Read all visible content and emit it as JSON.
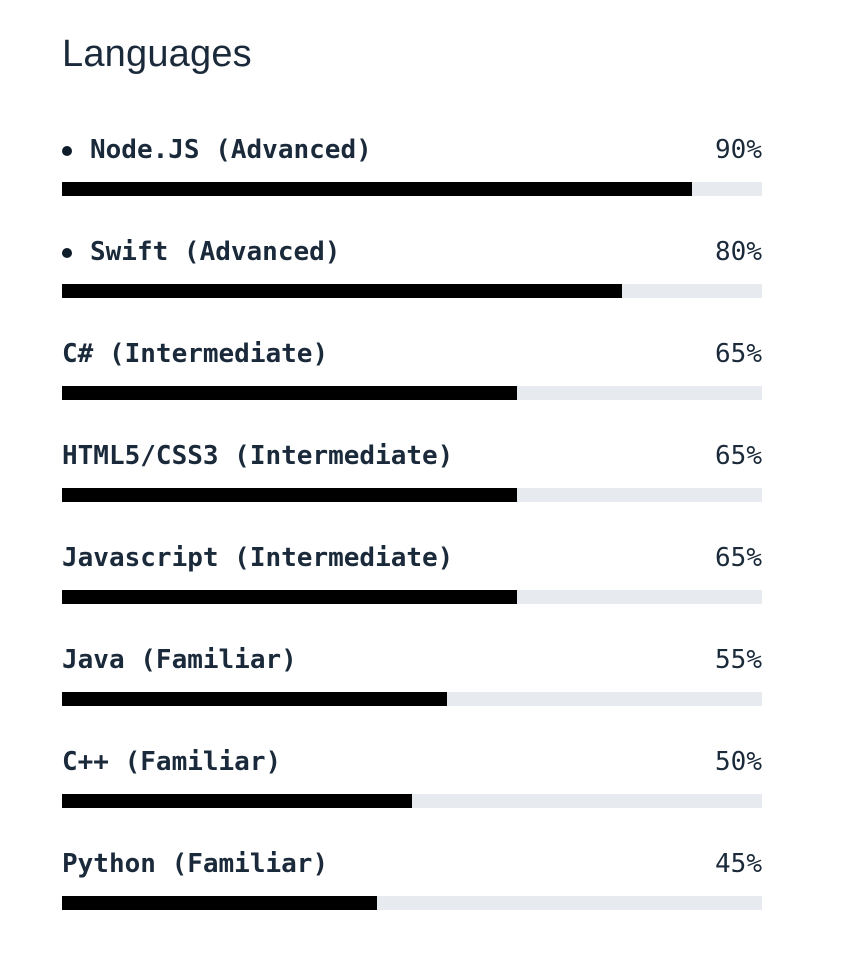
{
  "section": {
    "title": "Languages"
  },
  "skills": [
    {
      "name": "Node.JS (Advanced)",
      "percent_label": "90%",
      "level": 0.9,
      "bullet": true
    },
    {
      "name": "Swift (Advanced)",
      "percent_label": "80%",
      "level": 0.8,
      "bullet": true
    },
    {
      "name": "C# (Intermediate)",
      "percent_label": "65%",
      "level": 0.65,
      "bullet": false
    },
    {
      "name": "HTML5/CSS3 (Intermediate)",
      "percent_label": "65%",
      "level": 0.65,
      "bullet": false
    },
    {
      "name": "Javascript (Intermediate)",
      "percent_label": "65%",
      "level": 0.65,
      "bullet": false
    },
    {
      "name": "Java (Familiar)",
      "percent_label": "55%",
      "level": 0.55,
      "bullet": false
    },
    {
      "name": "C++ (Familiar)",
      "percent_label": "50%",
      "level": 0.5,
      "bullet": false
    },
    {
      "name": "Python (Familiar)",
      "percent_label": "45%",
      "level": 0.45,
      "bullet": false
    }
  ],
  "colors": {
    "text": "#1b2a3a",
    "bar_fill": "#000000",
    "bar_track": "#e7eaee"
  }
}
